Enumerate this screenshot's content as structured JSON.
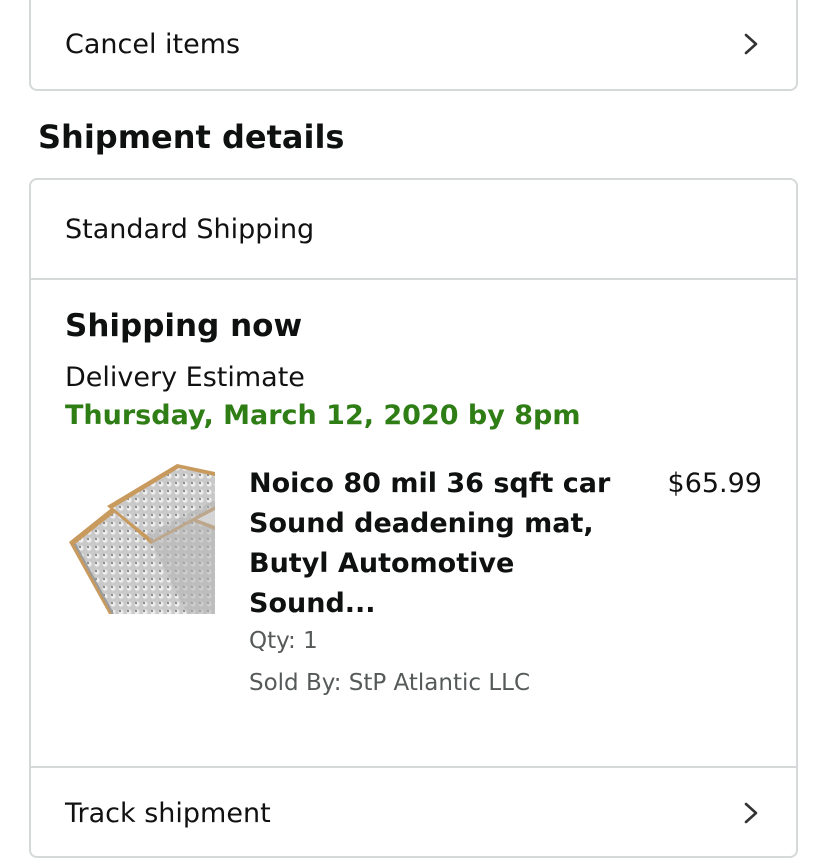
{
  "cancel": {
    "label": "Cancel items",
    "icon": "chevron-right-icon"
  },
  "shipment": {
    "heading": "Shipment details",
    "method": "Standard Shipping",
    "status": "Shipping now",
    "estimate_label": "Delivery Estimate",
    "estimate_date": "Thursday, March 12, 2020 by 8pm",
    "estimate_color": "#2e7d15",
    "item": {
      "title": "Noico 80 mil 36 sqft car Sound deadening mat, Butyl Automotive Sound...",
      "price": "$65.99",
      "qty": "Qty: 1",
      "seller": "Sold By: StP Atlantic LLC",
      "image": "sound-deadening-mat-photo"
    },
    "track_label": "Track shipment",
    "track_icon": "chevron-right-icon"
  },
  "colors": {
    "border": "#d5d9d9",
    "text": "#0f1111",
    "secondary_text": "#565959"
  }
}
